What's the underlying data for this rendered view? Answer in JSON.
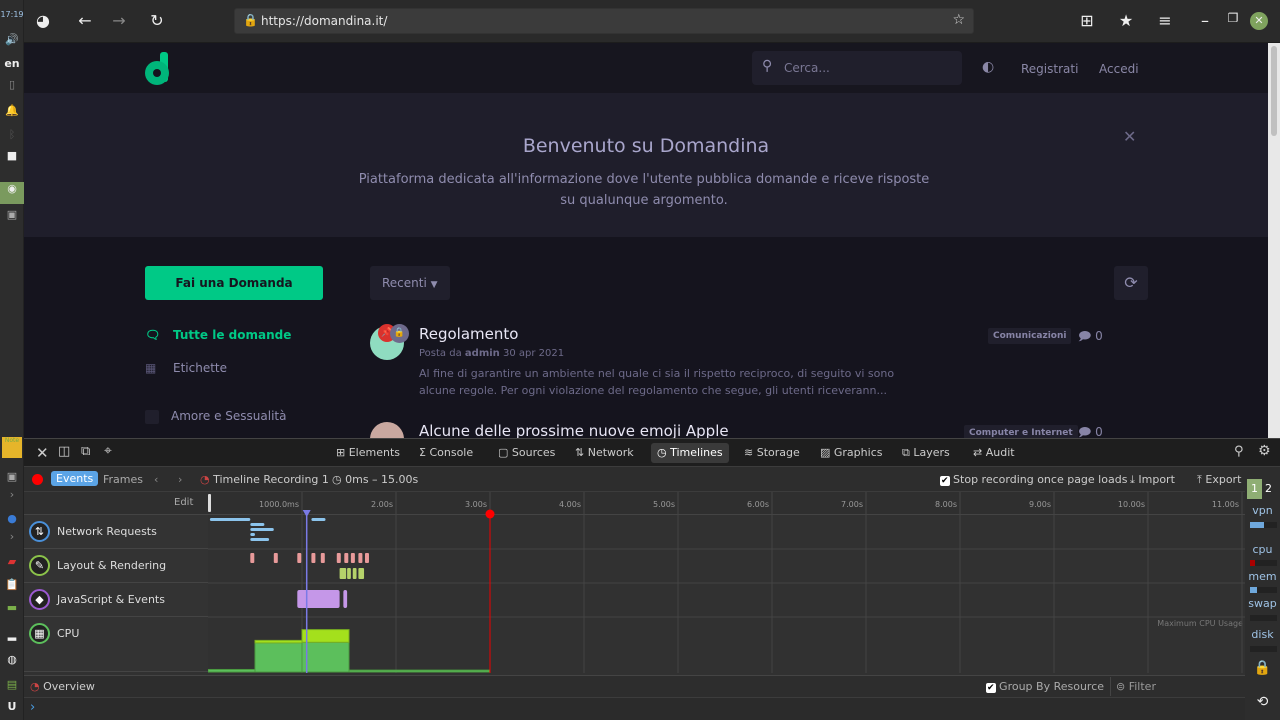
{
  "taskbar": {
    "clock": "17:19",
    "lang": "en",
    "icons": [
      "volume-icon",
      "keyboard-layout",
      "clipboard-icon",
      "bell-icon",
      "bluetooth-icon",
      "network-icon",
      "browser-icon",
      "terminal-icon",
      "notes-icon",
      "terminal-icon",
      "firefox-icon",
      "screenshot-icon",
      "clipboard-icon",
      "folder-icon",
      "drive-icon",
      "globe-icon",
      "window-icon",
      "app-icon"
    ]
  },
  "browser": {
    "url": "https://domandina.it/"
  },
  "site": {
    "search_placeholder": "Cerca...",
    "register": "Registrati",
    "login": "Accedi",
    "hero_title": "Benvenuto su Domandina",
    "hero_text": "Piattaforma dedicata all'informazione dove l'utente pubblica domande e riceve risposte su qualunque argomento.",
    "ask_button": "Fai una Domanda",
    "sort": "Recenti",
    "sidebar": [
      {
        "label": "Tutte le domande",
        "active": true
      },
      {
        "label": "Etichette"
      },
      {
        "label": "Amore e Sessualità"
      }
    ],
    "posts": [
      {
        "title": "Regolamento",
        "meta_prefix": "Posta da",
        "author": "admin",
        "date": "30 apr 2021",
        "excerpt": "Al fine di garantire un ambiente nel quale ci sia il rispetto reciproco, di seguito vi sono alcune regole. Per ogni violazione del regolamento che segue, gli utenti riceverann...",
        "tag": "Comunicazioni",
        "comments": "0"
      },
      {
        "title": "Alcune delle prossime nuove emoji Apple",
        "tag": "Computer e Internet",
        "comments": "0"
      }
    ],
    "accent": "#00c986"
  },
  "devtools": {
    "tabs": [
      "Elements",
      "Console",
      "Sources",
      "Network",
      "Timelines",
      "Storage",
      "Graphics",
      "Layers",
      "Audit"
    ],
    "active_tab": "Timelines",
    "events": "Events",
    "frames": "Frames",
    "recording": "Timeline Recording 1",
    "range": "0ms – 15.00s",
    "stop_recording": "Stop recording once page loads",
    "import": "Import",
    "export": "Export",
    "edit": "Edit",
    "ticks": [
      "1000.0ms",
      "2.00s",
      "3.00s",
      "4.00s",
      "5.00s",
      "6.00s",
      "7.00s",
      "8.00s",
      "9.00s",
      "10.00s",
      "11.00s"
    ],
    "rows": [
      "Network Requests",
      "Layout & Rendering",
      "JavaScript & Events",
      "CPU"
    ],
    "cpu_note": "Maximum CPU Usage",
    "overview": "Overview",
    "group_by_resource": "Group By Resource",
    "filter_placeholder": "Filter",
    "playhead_s": 1.05,
    "record_end_s": 3.0,
    "network": [
      [
        0.02,
        0.45,
        0
      ],
      [
        1.15,
        1.25,
        0
      ],
      [
        0.45,
        0.6,
        1
      ],
      [
        0.45,
        0.7,
        2
      ],
      [
        0.45,
        0.5,
        3
      ],
      [
        0.45,
        0.65,
        4
      ],
      [
        1.1,
        1.2,
        0
      ]
    ],
    "layout": [
      0.45,
      0.7,
      0.95,
      1.1,
      1.2,
      1.37,
      1.45,
      1.52,
      1.6,
      1.67
    ],
    "paint": [
      [
        1.4,
        1.47
      ],
      [
        1.48,
        1.52
      ],
      [
        1.54,
        1.58
      ],
      [
        1.6,
        1.66
      ]
    ],
    "scripts": [
      [
        0.95,
        1.4
      ],
      [
        1.44,
        1.48
      ]
    ],
    "cpu": [
      [
        0,
        0.5,
        4,
        0
      ],
      [
        0.5,
        1.0,
        46,
        4
      ],
      [
        1.0,
        1.5,
        47,
        20
      ],
      [
        1.5,
        3.0,
        3,
        0
      ]
    ]
  },
  "right_panel": {
    "workspaces": [
      "1",
      "2"
    ],
    "monitors": [
      "vpn",
      "cpu",
      "mem",
      "swap",
      "disk"
    ],
    "vpn": 0.5,
    "cpu": 0.6,
    "mem": 0.6,
    "swap": 0,
    "disk": 0
  }
}
